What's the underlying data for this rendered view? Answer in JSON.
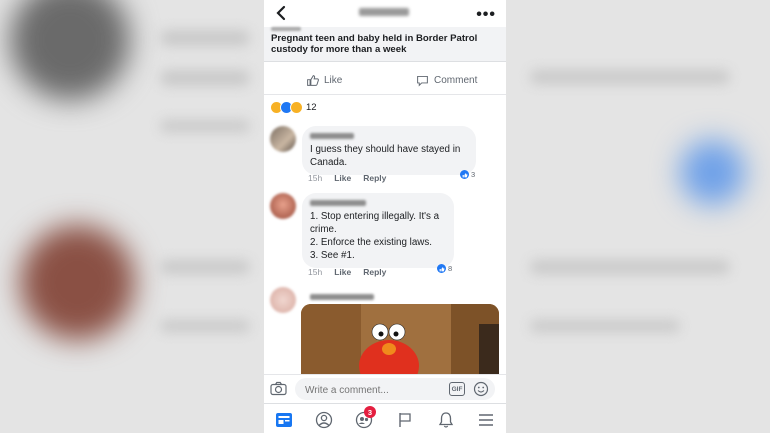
{
  "header": {
    "back_icon": "chevron-left-icon",
    "title": "",
    "more_icon": "ellipsis-icon"
  },
  "post": {
    "headline": "Pregnant teen and baby held in Border Patrol custody for more than a week",
    "like_label": "Like",
    "comment_label": "Comment",
    "reaction_count": "12",
    "reaction_types": [
      "haha",
      "like",
      "wow"
    ]
  },
  "comments": [
    {
      "text": "I guess they should have stayed in\nCanada.",
      "time": "15h",
      "like_label": "Like",
      "reply_label": "Reply",
      "likes": "3"
    },
    {
      "text": "1. Stop entering illegally. It's a\ncrime.\n2. Enforce the existing laws.\n3. See #1.",
      "time": "15h",
      "like_label": "Like",
      "reply_label": "Reply",
      "likes": "8"
    }
  ],
  "composer": {
    "placeholder": "Write a comment...",
    "gif_label": "GIF"
  },
  "tabbar": {
    "items": [
      "news-feed-icon",
      "profile-icon",
      "friends-icon",
      "flag-icon",
      "bell-icon",
      "menu-icon"
    ],
    "friends_badge": "3"
  },
  "colors": {
    "accent": "#1877f2",
    "badge": "#e41e3f",
    "bubble": "#f2f3f5"
  }
}
